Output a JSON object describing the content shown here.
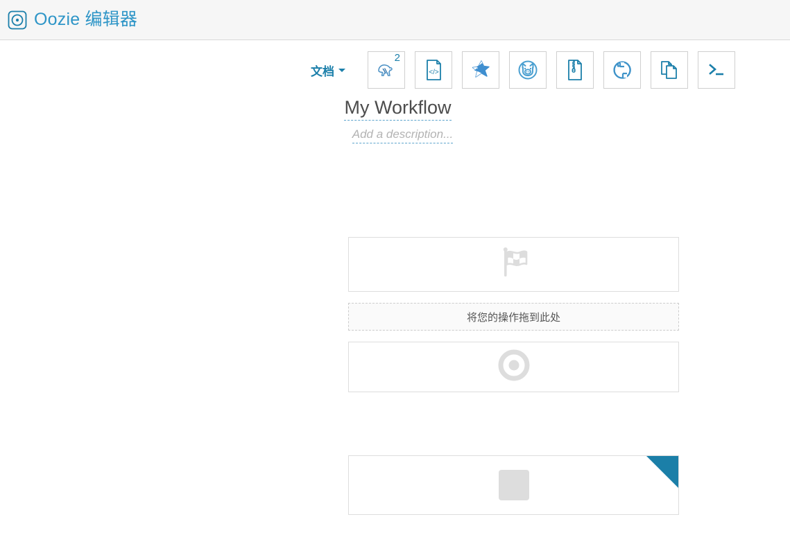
{
  "header": {
    "logo_icon": "target-circle-icon",
    "title": "Oozie 编辑器"
  },
  "toolbar": {
    "doc_menu_label": "文档",
    "caret_icon": "chevron-down-icon",
    "actions": [
      {
        "name": "hive-action",
        "icon": "hive-elephant-icon",
        "badge": "2"
      },
      {
        "name": "xml-action",
        "icon": "xml-document-icon",
        "badge": ""
      },
      {
        "name": "spark-action",
        "icon": "spark-star-icon",
        "badge": ""
      },
      {
        "name": "pig-action",
        "icon": "pig-face-icon",
        "badge": ""
      },
      {
        "name": "jar-action",
        "icon": "zip-file-icon",
        "badge": ""
      },
      {
        "name": "sqoop-action",
        "icon": "circle-arrow-icon",
        "badge": ""
      },
      {
        "name": "fs-action",
        "icon": "copy-files-icon",
        "badge": ""
      },
      {
        "name": "shell-action",
        "icon": "terminal-prompt-icon",
        "badge": ""
      }
    ]
  },
  "workflow": {
    "name": "My Workflow",
    "description_placeholder": "Add a description...",
    "nodes": {
      "start": {
        "icon": "checkered-flag-icon"
      },
      "drop_zone_label": "将您的操作拖到此处",
      "end": {
        "icon": "bullseye-target-icon"
      },
      "action": {
        "icon": "action-placeholder-icon",
        "settings_icon": "gears-icon"
      }
    }
  },
  "colors": {
    "brand_blue": "#2e95c7",
    "accent_blue": "#1b7faa",
    "corner_teal": "#1b7fa8",
    "header_bg": "#f6f6f6",
    "node_border": "#dddddd",
    "muted_gray": "#dddddd"
  }
}
